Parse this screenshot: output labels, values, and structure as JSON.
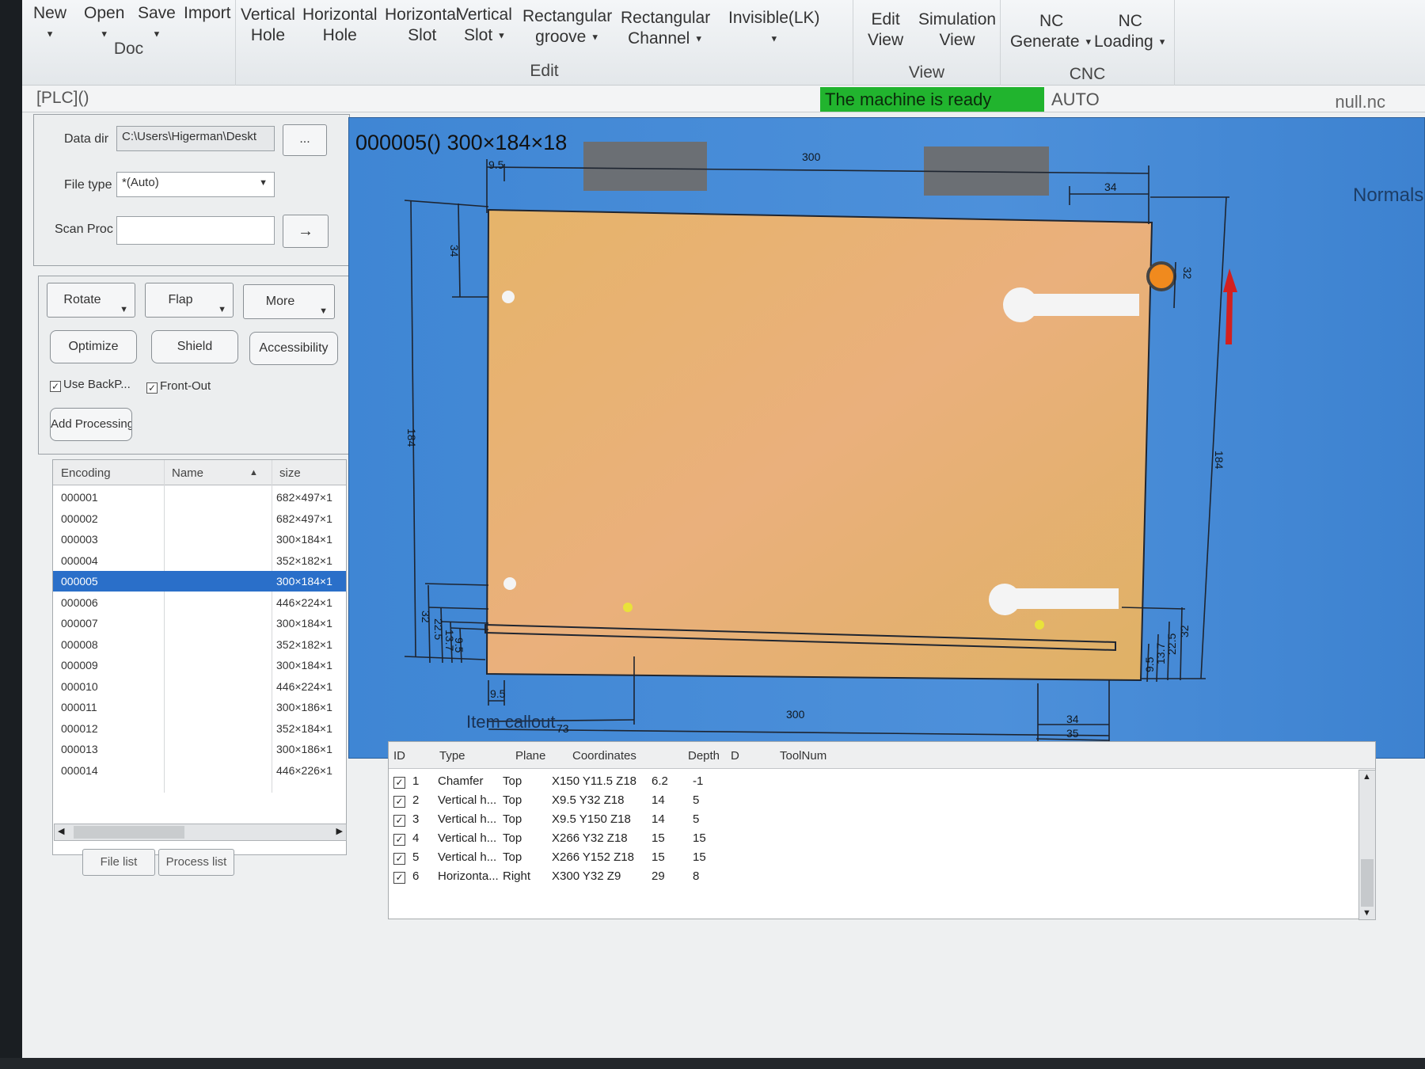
{
  "ribbon": {
    "doc": {
      "new": "New",
      "open": "Open",
      "save": "Save",
      "import": "Import",
      "label": "Doc"
    },
    "edit": {
      "vhole": [
        "Vertical",
        "Hole"
      ],
      "hhole": [
        "Horizontal",
        "Hole"
      ],
      "hslot": [
        "Horizontal",
        "Slot"
      ],
      "vslot": [
        "Vertical",
        "Slot"
      ],
      "rgroove": [
        "Rectangular",
        "groove"
      ],
      "rchannel": [
        "Rectangular",
        "Channel"
      ],
      "invisible": "Invisible(LK)",
      "label": "Edit"
    },
    "view": {
      "edit": [
        "Edit",
        "View"
      ],
      "sim": [
        "Simulation",
        "View"
      ],
      "label": "View"
    },
    "cnc": {
      "gen": [
        "NC",
        "Generate"
      ],
      "load": [
        "NC",
        "Loading"
      ],
      "label": "CNC"
    }
  },
  "status": {
    "plc": "[PLC]()",
    "ready": "The machine is ready",
    "mode": "AUTO",
    "nc_file": "null.nc"
  },
  "left": {
    "data_dir_label": "Data dir",
    "data_dir_value": "C:\\Users\\Higerman\\Deskt",
    "browse": "...",
    "file_type_label": "File type",
    "file_type_value": "*(Auto)",
    "scan_label": "Scan Proc",
    "scan_value": "",
    "go": "→",
    "rotate": "Rotate",
    "flap": "Flap",
    "more": "More",
    "optimize": "Optimize",
    "shield": "Shield",
    "accessibility": "Accessibility",
    "use_back": "Use BackP...",
    "front_out": "Front-Out",
    "add_processing": "Add Processing",
    "tab_file_list": "File list",
    "tab_process_list": "Process list"
  },
  "files": {
    "headers": {
      "encoding": "Encoding",
      "name": "Name",
      "size": "size"
    },
    "rows": [
      {
        "enc": "000001",
        "size": "682×497×1"
      },
      {
        "enc": "000002",
        "size": "682×497×1"
      },
      {
        "enc": "000003",
        "size": "300×184×1"
      },
      {
        "enc": "000004",
        "size": "352×182×1"
      },
      {
        "enc": "000005",
        "size": "300×184×1"
      },
      {
        "enc": "000006",
        "size": "446×224×1"
      },
      {
        "enc": "000007",
        "size": "300×184×1"
      },
      {
        "enc": "000008",
        "size": "352×182×1"
      },
      {
        "enc": "000009",
        "size": "300×184×1"
      },
      {
        "enc": "000010",
        "size": "446×224×1"
      },
      {
        "enc": "000011",
        "size": "300×186×1"
      },
      {
        "enc": "000012",
        "size": "352×184×1"
      },
      {
        "enc": "000013",
        "size": "300×186×1"
      },
      {
        "enc": "000014",
        "size": "446×226×1"
      }
    ],
    "selected_index": 4
  },
  "canvas": {
    "title": "000005() 300×184×18",
    "normals": "Normals",
    "callout": "Item callout",
    "dims": {
      "top_width": "300",
      "top_left": "9.5",
      "top_right": "34",
      "left_total": "184",
      "left_top": "34",
      "right_total": "184",
      "right_top": "32",
      "bottom_width": "300",
      "bottom_left": "9.5",
      "bottom_73": "73",
      "bottom_34": "34",
      "bottom_35": "35",
      "left_32": "32",
      "left_225": "22.5",
      "left_137": "13.7",
      "left_95": "9.5",
      "right_32": "32",
      "right_225": "22.5",
      "right_137": "13.7",
      "right_95": "9.5"
    }
  },
  "process": {
    "headers": {
      "id": "ID",
      "type": "Type",
      "plane": "Plane",
      "coords": "Coordinates",
      "depth": "Depth",
      "d": "D",
      "tool": "ToolNum"
    },
    "rows": [
      {
        "id": "1",
        "type": "Chamfer",
        "plane": "Top",
        "coords": "X150 Y11.5 Z18",
        "depth": "6.2",
        "d": "-1"
      },
      {
        "id": "2",
        "type": "Vertical h...",
        "plane": "Top",
        "coords": "X9.5 Y32 Z18",
        "depth": "14",
        "d": "5"
      },
      {
        "id": "3",
        "type": "Vertical h...",
        "plane": "Top",
        "coords": "X9.5 Y150 Z18",
        "depth": "14",
        "d": "5"
      },
      {
        "id": "4",
        "type": "Vertical h...",
        "plane": "Top",
        "coords": "X266 Y32 Z18",
        "depth": "15",
        "d": "15"
      },
      {
        "id": "5",
        "type": "Vertical h...",
        "plane": "Top",
        "coords": "X266 Y152 Z18",
        "depth": "15",
        "d": "15"
      },
      {
        "id": "6",
        "type": "Horizonta...",
        "plane": "Right",
        "coords": "X300 Y32 Z9",
        "depth": "29",
        "d": "8"
      }
    ]
  }
}
